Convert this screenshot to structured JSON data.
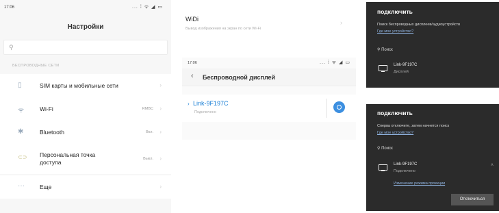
{
  "settings": {
    "time": "17:06",
    "status_icons": "... ⁞ ᯤ ◢ ▭",
    "title": "Настройки",
    "search_icon": "search-icon",
    "section": "БЕСПРОВОДНЫЕ СЕТИ",
    "items": [
      {
        "icon": "sim-card-icon",
        "glyph": "▯",
        "label": "SIM карты и мобильные сети",
        "value": ""
      },
      {
        "icon": "wifi-icon",
        "glyph": "ᯤ",
        "label": "Wi-Fi",
        "value": "RMBC"
      },
      {
        "icon": "bluetooth-icon",
        "glyph": "✱",
        "label": "Bluetooth",
        "value": "Вкл."
      },
      {
        "icon": "hotspot-icon",
        "glyph": "⊂⊃",
        "label": "Персональная точка доступа",
        "value": "Выкл."
      },
      {
        "icon": "more-icon",
        "glyph": "···",
        "label": "Еще",
        "value": ""
      }
    ]
  },
  "widi": {
    "title": "WiDi",
    "subtitle": "Вывод изображения на экран по сети Wi-Fi"
  },
  "wireless": {
    "time": "17:06",
    "status_icons": "... ⁞ ᯤ ◢ ▭",
    "title": "Беспроводной дисплей",
    "device_name": "Link-9F197C",
    "device_status": "Подключено"
  },
  "connect_before": {
    "title": "подключить",
    "desc": "Поиск беспроводных дисплеев/аудиоустройств",
    "link": "Где мое устройство?",
    "search": "Поиск",
    "device_name": "Link-9F197C",
    "device_status": "Дисплей"
  },
  "connect_after": {
    "title": "подключить",
    "desc": "Сперва отключите, затем начнется поиск",
    "link": "Где мое устройство?",
    "search": "Поиск",
    "device_name": "Link-9F197C",
    "device_status": "Подключено",
    "mode_link": "Изменение режима проекции",
    "disconnect": "Отключиться"
  }
}
